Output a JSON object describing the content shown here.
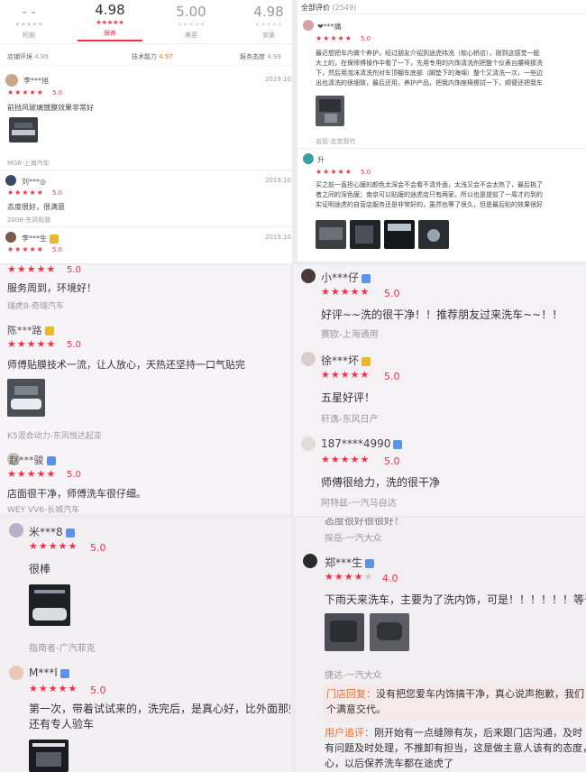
{
  "ratings_header": {
    "cols": [
      {
        "score": "- -",
        "stars": "★★★★★",
        "label": "轮胎",
        "active": false
      },
      {
        "score": "4.98",
        "stars": "★★★★★",
        "label": "保养",
        "active": true
      },
      {
        "score": "5.00",
        "stars": "★★★★★",
        "label": "美容",
        "active": false
      },
      {
        "score": "4.98",
        "stars": "★★★★★",
        "label": "安装",
        "active": false
      }
    ],
    "metrics": [
      {
        "label": "店铺环境",
        "value": "4.99"
      },
      {
        "label": "技术能力",
        "value": "4.97"
      },
      {
        "label": "服务态度",
        "value": "4.99"
      }
    ]
  },
  "left_top_reviews": [
    {
      "user": "李***旭",
      "date": "2019.10.",
      "stars": "★★★★★",
      "score": "5.0",
      "text": "前挡风玻璃镀膜效果非常好",
      "car": "MG6-上海汽车"
    },
    {
      "user": "刘***◎",
      "date": "2019.10.",
      "stars": "★★★★★",
      "score": "5.0",
      "text": "态度很好，很满意",
      "car": "2008-东风标致"
    },
    {
      "user": "李***生",
      "date": "2019.10.",
      "stars": "★★★★★",
      "score": "5.0"
    }
  ],
  "right_top": {
    "title": "全部评价",
    "count": "(2549)",
    "reviews": [
      {
        "user": "❤***痛",
        "stars": "★★★★★",
        "score": "5.0",
        "lines": [
          "最近想把车内做个养护，经过朋友介绍到途虎纬洗（软心桥店），刚到这感觉一股",
          "大上的，在保师傅操作中看了一下，先用专用的内饰清洗剂把整个仪表台腰椅那洗",
          "下，然后用泡沫清洗剂对车顶棚车底部（脚垫下的海绵）整个又清洗一次，一些边",
          "出也清洗的很细致，最后还用，养护产品，把我内饰座椅擦拭一下，顺便还把我车"
        ],
        "car": "名驭-北京现代"
      },
      {
        "user": "升",
        "stars": "★★★★★",
        "score": "5.0",
        "lines": [
          "买之前一直担心膜的颜色太深会不会看不清外面，太浅又会不会太热了，最后挑了",
          "者之间的深色膜；南京可以贴膜的途虎店只有两家，所以也是提前了一周才约到的",
          "实证明途虎的自营店服务还是非常好的，虽然也等了很久，但是最后贴的效果很好"
        ]
      }
    ]
  },
  "mid_left_reviews": [
    {
      "stars": "★★★★★",
      "score": "5.0",
      "text": "服务周到，环境好！",
      "car": "瑞虎8-奇瑞汽车"
    },
    {
      "user": "陈***路",
      "stars": "★★★★★",
      "score": "5.0",
      "text": "师傅贴膜技术一流，让人放心，天热还坚持一口气贴完",
      "car": "K5混合动力-东风悦达起亚"
    },
    {
      "user": "赵***骏",
      "stars": "★★★★★",
      "score": "5.0",
      "text": "店面很干净，师傅洗车很仔细。",
      "car": "WEY VV6-长城汽车"
    }
  ],
  "mid_right_reviews": [
    {
      "user": "小***仔",
      "stars": "★★★★★",
      "score": "5.0",
      "text": "好评~~洗的很干净！！推荐朋友过来洗车~~！！",
      "car": "赛欧-上海通用"
    },
    {
      "user": "徐***坏",
      "stars": "★★★★★",
      "score": "5.0",
      "text": "五星好评！",
      "car": "轩逸-东风日产"
    },
    {
      "user": "187****4990",
      "stars": "★★★★★",
      "score": "5.0",
      "text": "师傅很给力，洗的很干净",
      "car": "阿特兹-一汽马自达"
    }
  ],
  "bottom_left_reviews": [
    {
      "user": "米***8",
      "stars": "★★★★★",
      "score": "5.0",
      "text": "很棒",
      "car": "指南者-广汽菲克"
    },
    {
      "user": "M***l",
      "stars": "★★★★★",
      "score": "5.0",
      "lines": [
        "第一次，带着试试来的，洗完后，是真心好，比外面那些(",
        "还有专人验车"
      ]
    }
  ],
  "bottom_right": {
    "partial_text": "态度很好很很好！",
    "first_car": "探岳-一汽大众",
    "review": {
      "user": "郑***生",
      "stars": "★★★★",
      "star_empty": "★",
      "score": "4.0",
      "text": "下雨天来洗车，主要为了洗内饰，可是！！！！！！等于没洗",
      "car": "捷达-一汽大众"
    },
    "shop_reply": {
      "label": "门店回复：",
      "lines": [
        "没有把您爱车内饰搞干净，真心说声抱歉，我们",
        "个满意交代。"
      ]
    },
    "user_followup": {
      "label": "用户追评：",
      "lines": [
        "刚开始有一点缝隙有灰，后来跟门店沟通，及时",
        "有问题及时处理，不推卸有担当，这是做主意人该有的态度，",
        "心，以后保养洗车都在途虎了"
      ]
    }
  },
  "colors": {
    "accent": "#ee3344",
    "badge_blue": "#5d93e6",
    "reply_label": "#e6712e"
  }
}
